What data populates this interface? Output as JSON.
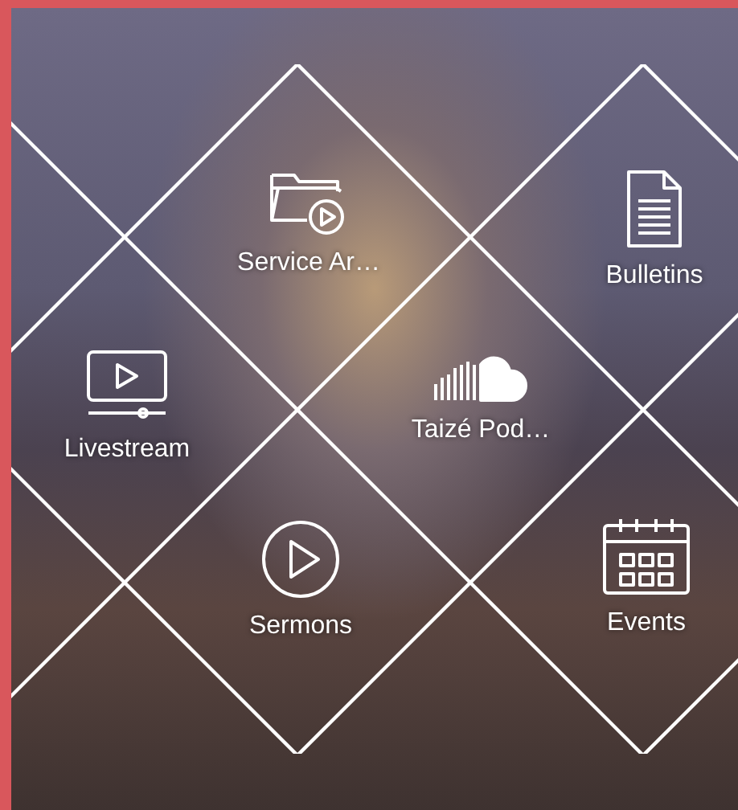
{
  "tiles": [
    {
      "kind": "folder-play",
      "label": "Service Ar…"
    },
    {
      "kind": "document",
      "label": "Bulletins"
    },
    {
      "kind": "video",
      "label": "Livestream"
    },
    {
      "kind": "cloud",
      "label": "Taizé Pod…"
    },
    {
      "kind": "play",
      "label": "Sermons"
    },
    {
      "kind": "calendar",
      "label": "Events"
    }
  ]
}
